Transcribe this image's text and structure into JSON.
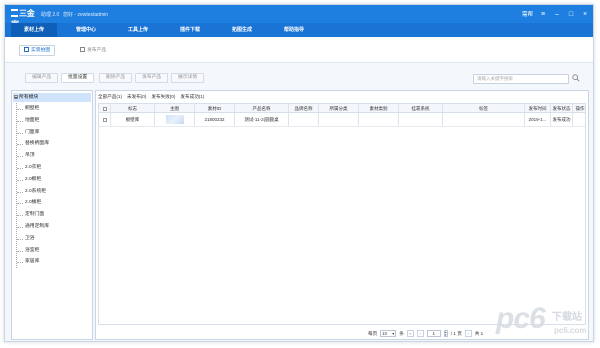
{
  "app": {
    "logo_text": "三金家",
    "version": "助理 2.0",
    "user": "您好 - zewtestadmin"
  },
  "window_controls": {
    "help_label": "需帮",
    "menu_icon": "list-icon",
    "minimize_icon": "minimize-icon",
    "maximize_icon": "maximize-icon",
    "close_icon": "close-icon"
  },
  "nav": {
    "items": [
      {
        "label": "素材上传",
        "active": true
      },
      {
        "label": "管理中心",
        "active": false
      },
      {
        "label": "工具上传",
        "active": false
      },
      {
        "label": "插件下载",
        "active": false
      },
      {
        "label": "拓图生成",
        "active": false
      },
      {
        "label": "帮助指导",
        "active": false
      }
    ]
  },
  "toolbar": {
    "new_label": "实景拍图",
    "publish_label": "发布产品"
  },
  "actions": {
    "edit_label": "编辑产品",
    "batch_label": "批量设置",
    "delete_label": "删除产品",
    "publish_label": "发布产品",
    "detail_label": "展示详情"
  },
  "search": {
    "placeholder": "请输入关键字搜索"
  },
  "tree": {
    "root_label": "所有模块",
    "items": [
      "橱壁柜",
      "地面柜",
      "门面库",
      "替换柄面库",
      "吊顶",
      "2.0衣柜",
      "2.0橱柜",
      "2.0系统柜",
      "2.0桶柜",
      "定制门面",
      "通用定制库",
      "卫浴",
      "浴室柜",
      "家居库"
    ]
  },
  "tabs": [
    "全部产品(1)",
    "未发布(0)",
    "发布失败(0)",
    "发布成功(1)"
  ],
  "table": {
    "headers": [
      "",
      "标志",
      "主图",
      "素材ID",
      "产品名称",
      "品牌名称",
      "所属分类",
      "素材类别",
      "挂靠系统",
      "标签",
      "发布时间",
      "发布状态",
      "操作"
    ],
    "rows": [
      [
        "",
        "橱壁库",
        "",
        "21800232",
        "测试-11-2(圆圆桌",
        "",
        "",
        "",
        "",
        "",
        "2019-1...",
        "发布成功",
        ""
      ]
    ]
  },
  "pager": {
    "per_page_label": "每页",
    "per_page_value": "10",
    "per_page_unit": "条",
    "page_value": "1",
    "total_pages": "/ 1 页",
    "total_label": "共 1"
  },
  "watermark": {
    "text": "pc6",
    "sub": "下载站",
    "url": "pc6.com"
  }
}
